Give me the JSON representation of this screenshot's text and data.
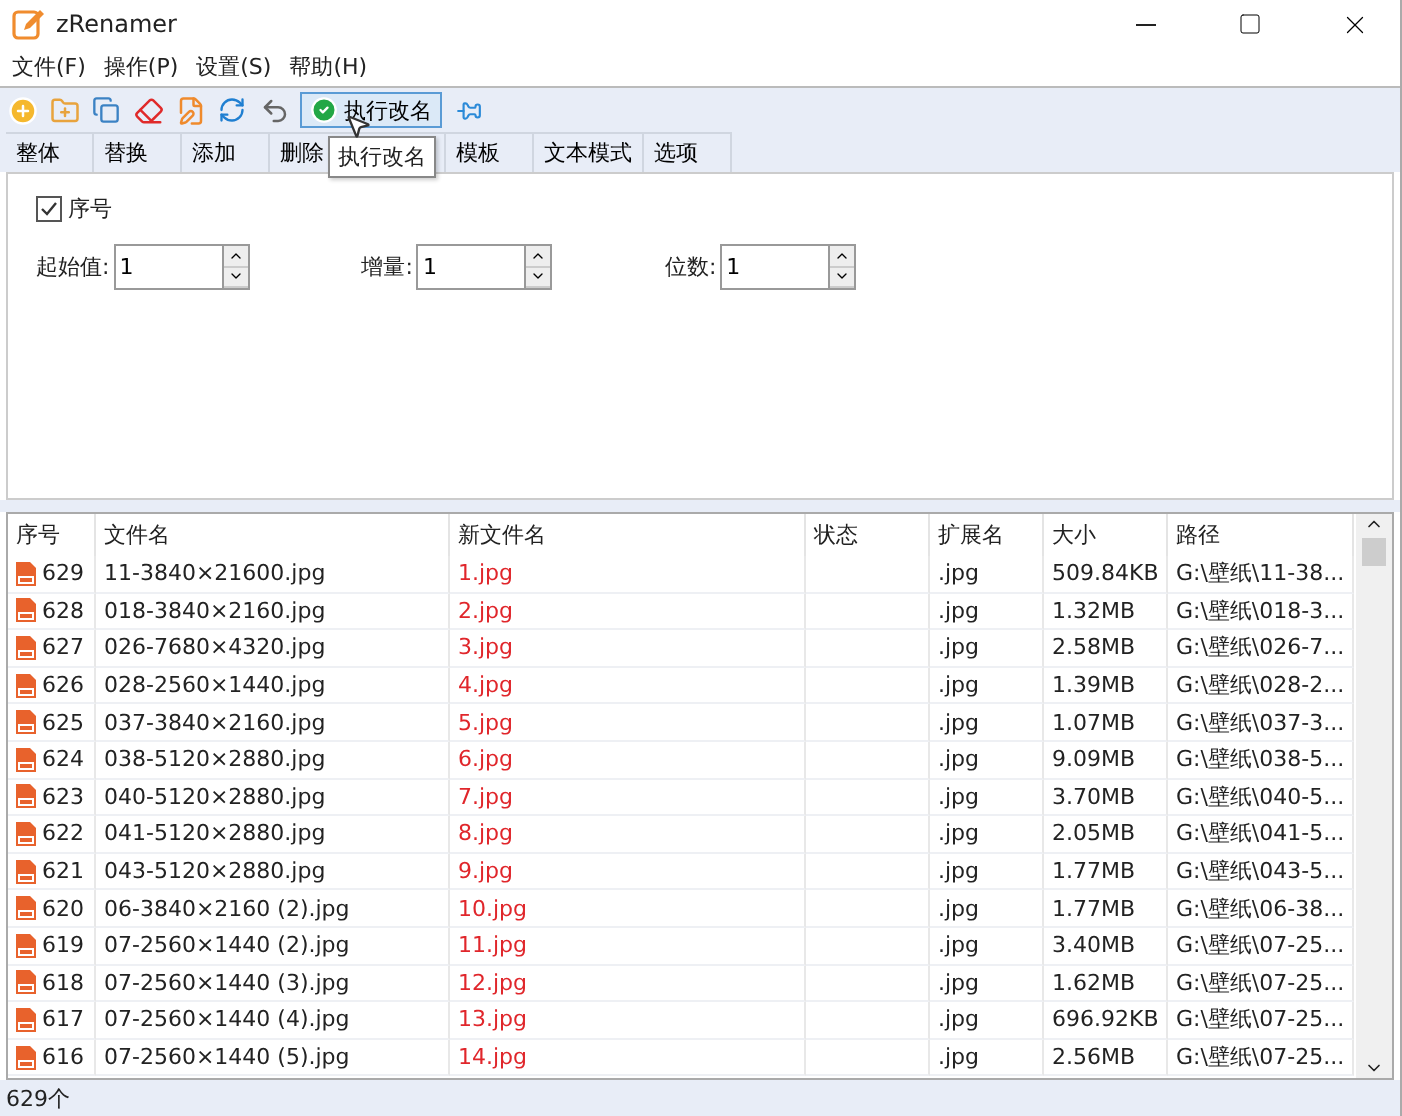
{
  "window": {
    "title": "zRenamer"
  },
  "menu": [
    "文件(F)",
    "操作(P)",
    "设置(S)",
    "帮助(H)"
  ],
  "toolbar": {
    "run_button": "执行改名",
    "tooltip": "执行改名"
  },
  "tabs": [
    {
      "label": "整体",
      "kind": "tab"
    },
    {
      "label": "替换",
      "kind": "tab"
    },
    {
      "label": "添加",
      "kind": "tab"
    },
    {
      "label": "删除",
      "kind": "tab"
    },
    {
      "kind": "covered"
    },
    {
      "label": "模板",
      "kind": "tab"
    },
    {
      "label": "文本模式",
      "kind": "tab"
    },
    {
      "label": "选项",
      "kind": "tab"
    }
  ],
  "panel": {
    "checkbox": {
      "label": "序号",
      "checked": true
    },
    "fields": [
      {
        "label": "起始值:",
        "value": "1"
      },
      {
        "label": "增量:",
        "value": "1"
      },
      {
        "label": "位数:",
        "value": "1"
      }
    ]
  },
  "table": {
    "columns": [
      "序号",
      "文件名",
      "新文件名",
      "状态",
      "扩展名",
      "大小",
      "路径"
    ],
    "rows": [
      [
        "629",
        "11-3840×21600.jpg",
        "1.jpg",
        "",
        ".jpg",
        "509.84KB",
        "G:\\壁纸\\11-38..."
      ],
      [
        "628",
        "018-3840×2160.jpg",
        "2.jpg",
        "",
        ".jpg",
        "1.32MB",
        "G:\\壁纸\\018-3..."
      ],
      [
        "627",
        "026-7680×4320.jpg",
        "3.jpg",
        "",
        ".jpg",
        "2.58MB",
        "G:\\壁纸\\026-7..."
      ],
      [
        "626",
        "028-2560×1440.jpg",
        "4.jpg",
        "",
        ".jpg",
        "1.39MB",
        "G:\\壁纸\\028-2..."
      ],
      [
        "625",
        "037-3840×2160.jpg",
        "5.jpg",
        "",
        ".jpg",
        "1.07MB",
        "G:\\壁纸\\037-3..."
      ],
      [
        "624",
        "038-5120×2880.jpg",
        "6.jpg",
        "",
        ".jpg",
        "9.09MB",
        "G:\\壁纸\\038-5..."
      ],
      [
        "623",
        "040-5120×2880.jpg",
        "7.jpg",
        "",
        ".jpg",
        "3.70MB",
        "G:\\壁纸\\040-5..."
      ],
      [
        "622",
        "041-5120×2880.jpg",
        "8.jpg",
        "",
        ".jpg",
        "2.05MB",
        "G:\\壁纸\\041-5..."
      ],
      [
        "621",
        "043-5120×2880.jpg",
        "9.jpg",
        "",
        ".jpg",
        "1.77MB",
        "G:\\壁纸\\043-5..."
      ],
      [
        "620",
        "06-3840×2160 (2).jpg",
        "10.jpg",
        "",
        ".jpg",
        "1.77MB",
        "G:\\壁纸\\06-38..."
      ],
      [
        "619",
        "07-2560×1440 (2).jpg",
        "11.jpg",
        "",
        ".jpg",
        "3.40MB",
        "G:\\壁纸\\07-25..."
      ],
      [
        "618",
        "07-2560×1440 (3).jpg",
        "12.jpg",
        "",
        ".jpg",
        "1.62MB",
        "G:\\壁纸\\07-25..."
      ],
      [
        "617",
        "07-2560×1440 (4).jpg",
        "13.jpg",
        "",
        ".jpg",
        "696.92KB",
        "G:\\壁纸\\07-25..."
      ],
      [
        "616",
        "07-2560×1440 (5).jpg",
        "14.jpg",
        "",
        ".jpg",
        "2.56MB",
        "G:\\壁纸\\07-25..."
      ]
    ]
  },
  "status_bar": "629个"
}
